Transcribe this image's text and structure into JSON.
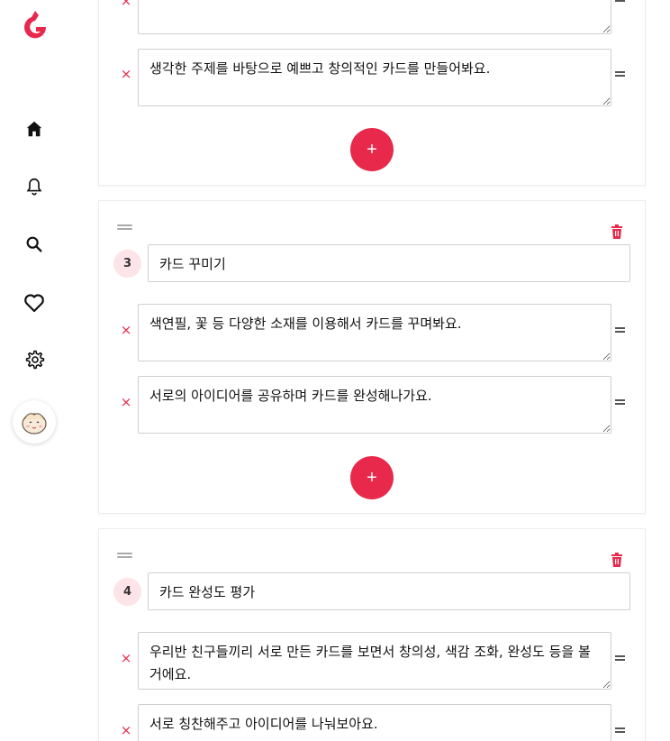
{
  "brand": {
    "accent": "#e8294c",
    "logo_letter": "G"
  },
  "nav": [
    {
      "name": "home-icon"
    },
    {
      "name": "bell-icon"
    },
    {
      "name": "search-icon"
    },
    {
      "name": "heart-icon"
    },
    {
      "name": "gear-icon"
    }
  ],
  "add_label": "+",
  "remove_label": "×",
  "card_top": {
    "rows": [
      {
        "text": ""
      },
      {
        "text": "생각한 주제를 바탕으로 예쁘고 창의적인 카드를 만들어봐요."
      }
    ]
  },
  "step3": {
    "number": "3",
    "title": "카드 꾸미기",
    "rows": [
      {
        "text": "색연필, 꽃 등 다양한 소재를 이용해서 카드를 꾸며봐요."
      },
      {
        "text": "서로의 아이디어를 공유하며 카드를 완성해나가요."
      }
    ]
  },
  "step4": {
    "number": "4",
    "title": "카드 완성도 평가",
    "rows": [
      {
        "text": "우리반 친구들끼리 서로 만든 카드를 보면서 창의성, 색감 조화, 완성도 등을 볼 거에요."
      },
      {
        "text": "서로 칭찬해주고 아이디어를 나눠보아요."
      }
    ]
  }
}
